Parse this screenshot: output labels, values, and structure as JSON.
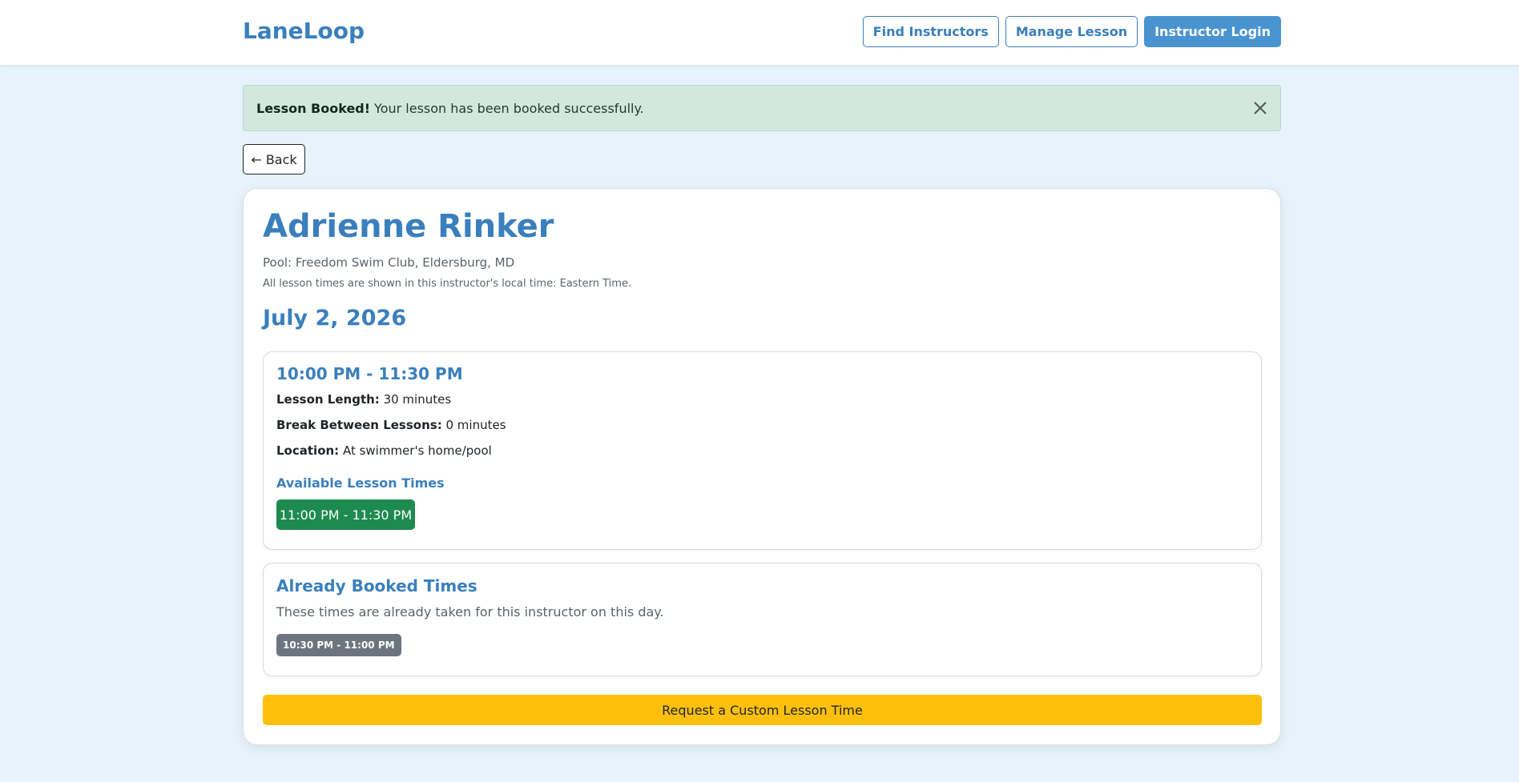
{
  "header": {
    "brand": "LaneLoop",
    "nav": {
      "find_instructors": "Find Instructors",
      "manage_lesson": "Manage Lesson",
      "instructor_login": "Instructor Login"
    }
  },
  "alert": {
    "title": "Lesson Booked!",
    "message": "Your lesson has been booked successfully."
  },
  "back_label": "← Back",
  "instructor": {
    "name": "Adrienne Rinker",
    "pool": "Pool: Freedom Swim Club, Eldersburg, MD",
    "timezone_note": "All lesson times are shown in this instructor's local time: Eastern Time."
  },
  "date": "July 2, 2026",
  "slot": {
    "time_range": "10:00 PM - 11:30 PM",
    "lesson_length_label": "Lesson Length:",
    "lesson_length": "30 minutes",
    "break_label": "Break Between Lessons:",
    "break_value": "0 minutes",
    "location_label": "Location:",
    "location": "At swimmer's home/pool",
    "available_heading": "Available Lesson Times",
    "available_times": [
      "11:00 PM - 11:30 PM"
    ]
  },
  "booked": {
    "title": "Already Booked Times",
    "description": "These times are already taken for this instructor on this day.",
    "times": [
      "10:30 PM - 11:00 PM"
    ]
  },
  "custom_request_label": "Request a Custom Lesson Time",
  "colors": {
    "brand": "#3a7fbd",
    "primary_button": "#4a93d1",
    "available": "#1d8a4f",
    "booked": "#6c757d",
    "custom_button": "#fcc00c",
    "alert_bg": "#d3e7df",
    "page_bg": "#e6f3fb"
  },
  "icons": {
    "alert_close": "close-icon"
  }
}
